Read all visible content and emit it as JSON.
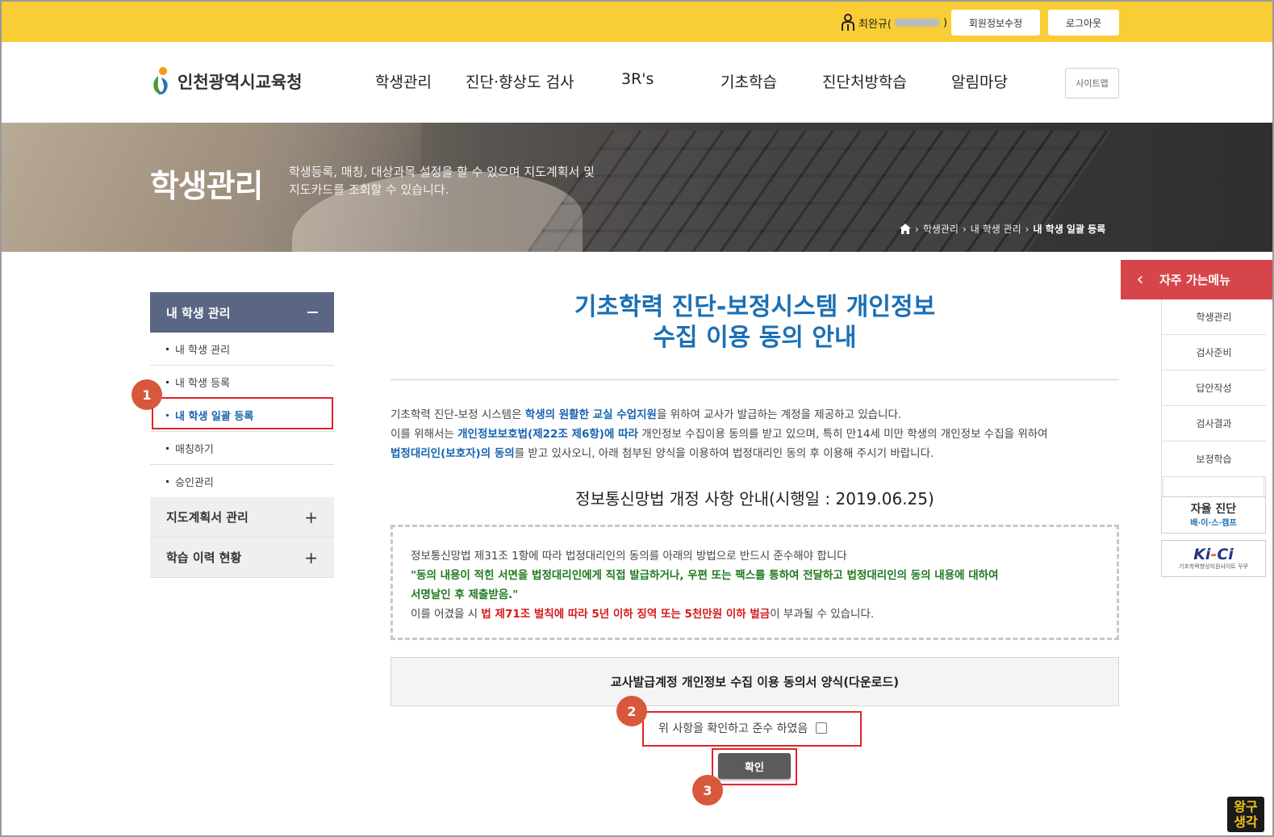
{
  "topbar": {
    "user_name": "최완규(",
    "user_name_end": ")",
    "member_edit": "회원정보수정",
    "logout": "로그아웃"
  },
  "header": {
    "logo_text": "인천광역시교육청",
    "nav": [
      "학생관리",
      "진단·향상도 검사",
      "3R's",
      "기초학습",
      "진단처방학습",
      "알림마당"
    ],
    "sitemap": "사이트맵"
  },
  "banner": {
    "title": "학생관리",
    "desc_line1": "학생등록, 매칭, 대상과목 설정을 할 수 있으며 지도계획서 및",
    "desc_line2": "지도카드를 조회할 수 있습니다.",
    "breadcrumb": [
      "학생관리",
      "내 학생 관리",
      "내 학생 일괄 등록"
    ]
  },
  "lnb": {
    "head": "내 학생 관리",
    "items": [
      "내 학생 관리",
      "내 학생 등록",
      "내 학생 일괄 등록",
      "매칭하기",
      "승인관리"
    ],
    "groups": [
      "지도계획서 관리",
      "학습 이력 현황"
    ]
  },
  "annotations": [
    "1",
    "2",
    "3"
  ],
  "main": {
    "title_line1": "기초학력 진단-보정시스템 개인정보",
    "title_line2": "수집 이용 동의 안내",
    "p1_a": "기초학력 진단-보정 시스템은 ",
    "p1_b": "학생의 원활한 교실 수업지원",
    "p1_c": "을 위하여 교사가 발급하는 계정을 제공하고 있습니다.",
    "p2_a": "이를 위해서는 ",
    "p2_b": "개인정보보호법(제22조 제6항)에 따라",
    "p2_c": " 개인정보 수집이용 동의를 받고 있으며, 특히 만14세 미만 학생의 개인정보 수집을 위하여",
    "p3_a": "법정대리인(보호자)의 동의",
    "p3_b": "를 받고 있사오니, 아래 첨부된 양식을 이용하여 법정대리인 동의 후 이용해 주시기 바랍니다.",
    "law_title": "정보통신망법 개정 사항 안내(시행일 : 2019.06.25)",
    "notice_1": "정보통신망법 제31조 1항에 따라 법정대리인의 동의를 아래의 방법으로 반드시 준수해야 합니다",
    "notice_2": "\"동의 내용이 적힌 서면을 법정대리인에게 직접 발급하거나, 우편 또는 팩스를 통하여 전달하고 법정대리인의 동의 내용에 대하여",
    "notice_3": "서명날인 후 제출받음.\"",
    "notice_4_a": "이를 어겼을 시 ",
    "notice_4_b": "법 제71조 벌칙에 따라 5년 이하 징역 또는 5천만원 이하 벌금",
    "notice_4_c": "이 부과될 수 있습니다.",
    "download": "교사발급계정 개인정보 수집 이용 동의서 양식(다운로드)",
    "agree_label": "위 사항을 확인하고 준수 하였음",
    "confirm": "확인"
  },
  "quick": {
    "head": "자주 가는메뉴",
    "items": [
      "학생관리",
      "검사준비",
      "답안작성",
      "검사결과",
      "보정학습"
    ],
    "banner1_title": "자율 진단",
    "banner1_sub_a": "배·이·스",
    "banner1_sub_b": "·캠프",
    "banner2_logo_a": "Ki",
    "banner2_logo_b": "-",
    "banner2_logo_c": "Ci",
    "banner2_sub": "기초학력향상지원사이트 꾸꾸"
  },
  "corner_mark": [
    "왕구",
    "생각"
  ],
  "colors": {
    "topbar": "#f9cd35",
    "lnb_head": "#5a6683",
    "title_blue": "#1b6fb4",
    "quick_red": "#d6454a",
    "annotation": "#d9573a"
  }
}
